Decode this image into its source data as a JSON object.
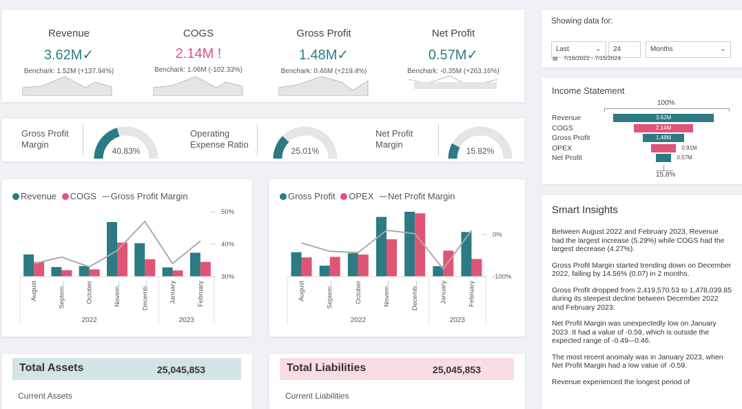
{
  "kpis": [
    {
      "title": "Revenue",
      "value": "3.62M",
      "mark": "✓",
      "color": "#2b7a84",
      "bench": "Benchark: 1.52M (+137.94%)"
    },
    {
      "title": "COGS",
      "value": "2.14M",
      "mark": "!",
      "color": "#e05575",
      "bench": "Benchark: 1.06M (-102.33%)"
    },
    {
      "title": "Gross Profit",
      "value": "1.48M",
      "mark": "✓",
      "color": "#2b7a84",
      "bench": "Benchark: 0.46M (+219.4%)"
    },
    {
      "title": "Net Profit",
      "value": "0.57M",
      "mark": "✓",
      "color": "#2b7a84",
      "bench": "Benchark: -0.35M (+263.16%)"
    }
  ],
  "gauges": [
    {
      "label": "Gross Profit Margin",
      "label_line1": "Gross Profit",
      "label_line2": "Margin",
      "value": "40.83%",
      "fraction": 0.4083
    },
    {
      "label": "Operating Expense Ratio",
      "label_line1": "Operating",
      "label_line2": "Expense Ratio",
      "value": "25.01%",
      "fraction": 0.2501
    },
    {
      "label": "Net Profit Margin",
      "label_line1": "Net Profit",
      "label_line2": "Margin",
      "value": "15.82%",
      "fraction": 0.1582
    }
  ],
  "filter": {
    "title": "Showing data for:",
    "mode": "Last",
    "count": "24",
    "unit": "Months",
    "range": "7/16/2022 - 7/15/2024"
  },
  "income": {
    "title": "Income Statement",
    "top": "100%",
    "bottom": "15.8%",
    "rows": [
      {
        "label": "Revenue",
        "value": "3.62M",
        "amount": 3.62,
        "color": "#2b7a84"
      },
      {
        "label": "COGS",
        "value": "2.14M",
        "amount": 2.14,
        "color": "#e05575"
      },
      {
        "label": "Gross Profit",
        "value": "1.48M",
        "amount": 1.48,
        "color": "#2b7a84"
      },
      {
        "label": "OPEX",
        "value": "0.91M",
        "amount": 0.91,
        "color": "#e05575"
      },
      {
        "label": "Net Profit",
        "value": "0.57M",
        "amount": 0.57,
        "color": "#2b7a84"
      }
    ]
  },
  "insights": {
    "title": "Smart Insights",
    "paragraphs": [
      "Between August 2022 and February 2023, Revenue had the largest increase (5.29%) while COGS had the largest decrease (4.27%).",
      "Gross Profit Margin started trending down on December 2022, falling by 14.56% (0.07) in 2 months.",
      "Gross Profit dropped from 2,419,570.53 to 1,478,039.85 during its steepest decline between December 2022 and February 2023.",
      "Net Profit Margin was unexpectedly low on January 2023. It had a value of -0.59, which is outside the expected range of -0.49–-0.46.",
      "The most recent anomaly was in January 2023, when Net Profit Margin had a low value of -0.59.",
      "Revenue experienced the longest period of"
    ]
  },
  "balance": {
    "assets": {
      "title": "Total Assets",
      "value": "25,045,853",
      "sub": "Current Assets"
    },
    "liabilities": {
      "title": "Total Liabilities",
      "value": "25,045,853",
      "sub": "Current Liabilities"
    }
  },
  "colors": {
    "teal": "#2b7a84",
    "pink": "#e05575",
    "line": "#aaaaaa"
  },
  "chart_data": [
    {
      "type": "bar",
      "legend": [
        "Revenue",
        "COGS",
        "Gross Profit Margin"
      ],
      "categories": [
        "August",
        "Septem...",
        "October",
        "Novem...",
        "Decemb...",
        "January",
        "February"
      ],
      "years": [
        "2022",
        "2023"
      ],
      "series": [
        {
          "name": "Revenue",
          "values": [
            0.65,
            0.28,
            0.31,
            1.6,
            0.98,
            0.27,
            0.7
          ]
        },
        {
          "name": "COGS",
          "values": [
            0.43,
            0.19,
            0.21,
            1.0,
            0.51,
            0.18,
            0.43
          ]
        }
      ],
      "line": {
        "name": "Gross Profit Margin",
        "values": [
          34,
          36,
          33,
          38,
          47,
          34,
          41
        ]
      },
      "right_ticks": [
        "50%",
        "40%",
        "30%"
      ],
      "right_range": [
        30,
        50
      ]
    },
    {
      "type": "bar",
      "legend": [
        "Gross Profit",
        "OPEX",
        "Net Profit Margin"
      ],
      "categories": [
        "August",
        "Septem...",
        "October",
        "Novem...",
        "Decemb...",
        "January",
        "February"
      ],
      "years": [
        "2022",
        "2023"
      ],
      "series": [
        {
          "name": "Gross Profit",
          "values": [
            0.94,
            0.42,
            0.9,
            2.3,
            2.5,
            0.4,
            1.72
          ]
        },
        {
          "name": "OPEX",
          "values": [
            0.74,
            0.76,
            0.85,
            1.44,
            2.44,
            1.0,
            0.68
          ]
        },
        {
          "name": "Net Profit Margin",
          "values": []
        }
      ],
      "line": {
        "name": "Net Profit Margin",
        "values": [
          -20,
          -40,
          -43,
          10,
          2,
          -82,
          10
        ]
      },
      "right_ticks": [
        "0%",
        "-100%"
      ],
      "right_range": [
        -100,
        0
      ]
    }
  ]
}
